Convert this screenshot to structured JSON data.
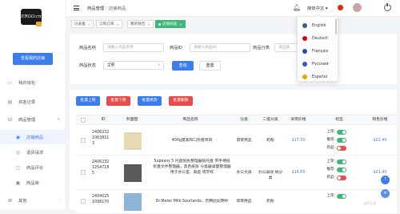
{
  "sidebar": {
    "logo_text": "ERGO.cn",
    "shop_button": "查看我的店铺",
    "items": [
      {
        "label": "我的钱包",
        "icon": "wallet-icon",
        "glyph": "▭",
        "chevron": ""
      },
      {
        "label": "资金记录",
        "icon": "fund-record-icon",
        "glyph": "▤",
        "chevron": ""
      },
      {
        "label": "商品管理",
        "icon": "goods-icon",
        "glyph": "⊟",
        "chevron": "∨"
      },
      {
        "label": "店铺商品",
        "icon": "shop-goods-icon",
        "glyph": "◉",
        "chevron": ""
      },
      {
        "label": "退货请求",
        "icon": "return-icon",
        "glyph": "◎",
        "chevron": ""
      },
      {
        "label": "商品评论",
        "icon": "comment-icon",
        "glyph": "▢",
        "chevron": ""
      },
      {
        "label": "商品库",
        "icon": "library-icon",
        "glyph": "▣",
        "chevron": ""
      },
      {
        "label": "其他",
        "icon": "other-icon",
        "glyph": "⊞",
        "chevron": "›"
      }
    ]
  },
  "header": {
    "breadcrumb": [
      "商品管理",
      "店铺商品"
    ],
    "breadcrumb_sep": "/",
    "language": "简体中文",
    "language_caret": "▾"
  },
  "tabs": [
    {
      "label": "仪表盘",
      "close": "×"
    },
    {
      "label": "订购订单",
      "close": "×"
    },
    {
      "label": "我的钱包",
      "close": "×"
    },
    {
      "label": "店铺商品",
      "close": "×"
    }
  ],
  "filters": {
    "name_label": "商品名称",
    "name_placeholder": "请输入商品名称",
    "id_label": "商品ID",
    "id_placeholder": "请输入商品ID",
    "cat_label": "商品分类",
    "cat_placeholder": "请选择",
    "status_label": "商品状态",
    "status_value": "全部",
    "caret": "∨",
    "query": "查询",
    "reset": "重置"
  },
  "actions": [
    {
      "label": "批量上架",
      "color": "#3b7ded"
    },
    {
      "label": "批量下架",
      "color": "#e84c4c"
    },
    {
      "label": "批量修改",
      "color": "#3b7ded"
    },
    {
      "label": "批量删除",
      "color": "#e84c4c"
    }
  ],
  "table": {
    "headers": [
      "ID",
      "封面图",
      "商品名称",
      "分类",
      "二级分类",
      "采购价格",
      "标签",
      "销售价格"
    ],
    "rows": [
      {
        "id": "2406232\n1063811\n3",
        "name": "400g量家和口热卷项目",
        "cat": "母婴用品",
        "sub": "奶粉",
        "cost": "$17.50",
        "sale": "$22.40",
        "labels": [
          "上架:",
          "推荐:",
          "新品:"
        ],
        "states": [
          "on",
          "on",
          "off"
        ]
      },
      {
        "id": "2406232\n1254718\n5",
        "name": "Supeasy 5 托盘纸张整理器纸托盘 带手柄纸张盘文件整理器，黑色纸张 分类器桌面整理器用于办公室、家庭 或学校",
        "cat": "办公文具",
        "sub": "办公桌收 纳分类",
        "cost": "$16.65",
        "sale": "$21.40",
        "labels": [
          "上架:",
          "推荐:",
          "新品:"
        ],
        "states": [
          "on",
          "on",
          "off"
        ]
      },
      {
        "id": "2404025\n1098170",
        "name": "Dr.Meter Milk Sourlands、奈腾此妃明呼",
        "cat": "母婴用品",
        "sub": "奶粉",
        "cost": "",
        "sale": "",
        "labels": [
          "上架:"
        ],
        "states": [
          "on"
        ]
      }
    ]
  },
  "languages": [
    {
      "label": "English",
      "flag": "#3c5a99"
    },
    {
      "label": "Deutsch",
      "flag": "#dd0000"
    },
    {
      "label": "Français",
      "flag": "#1f4fa8"
    },
    {
      "label": "Русский",
      "flag": "#2f5fb3"
    },
    {
      "label": "Español",
      "flag": "#e0a800"
    }
  ],
  "fabs": [
    "?",
    "≡"
  ],
  "watermark": "@IT之家"
}
